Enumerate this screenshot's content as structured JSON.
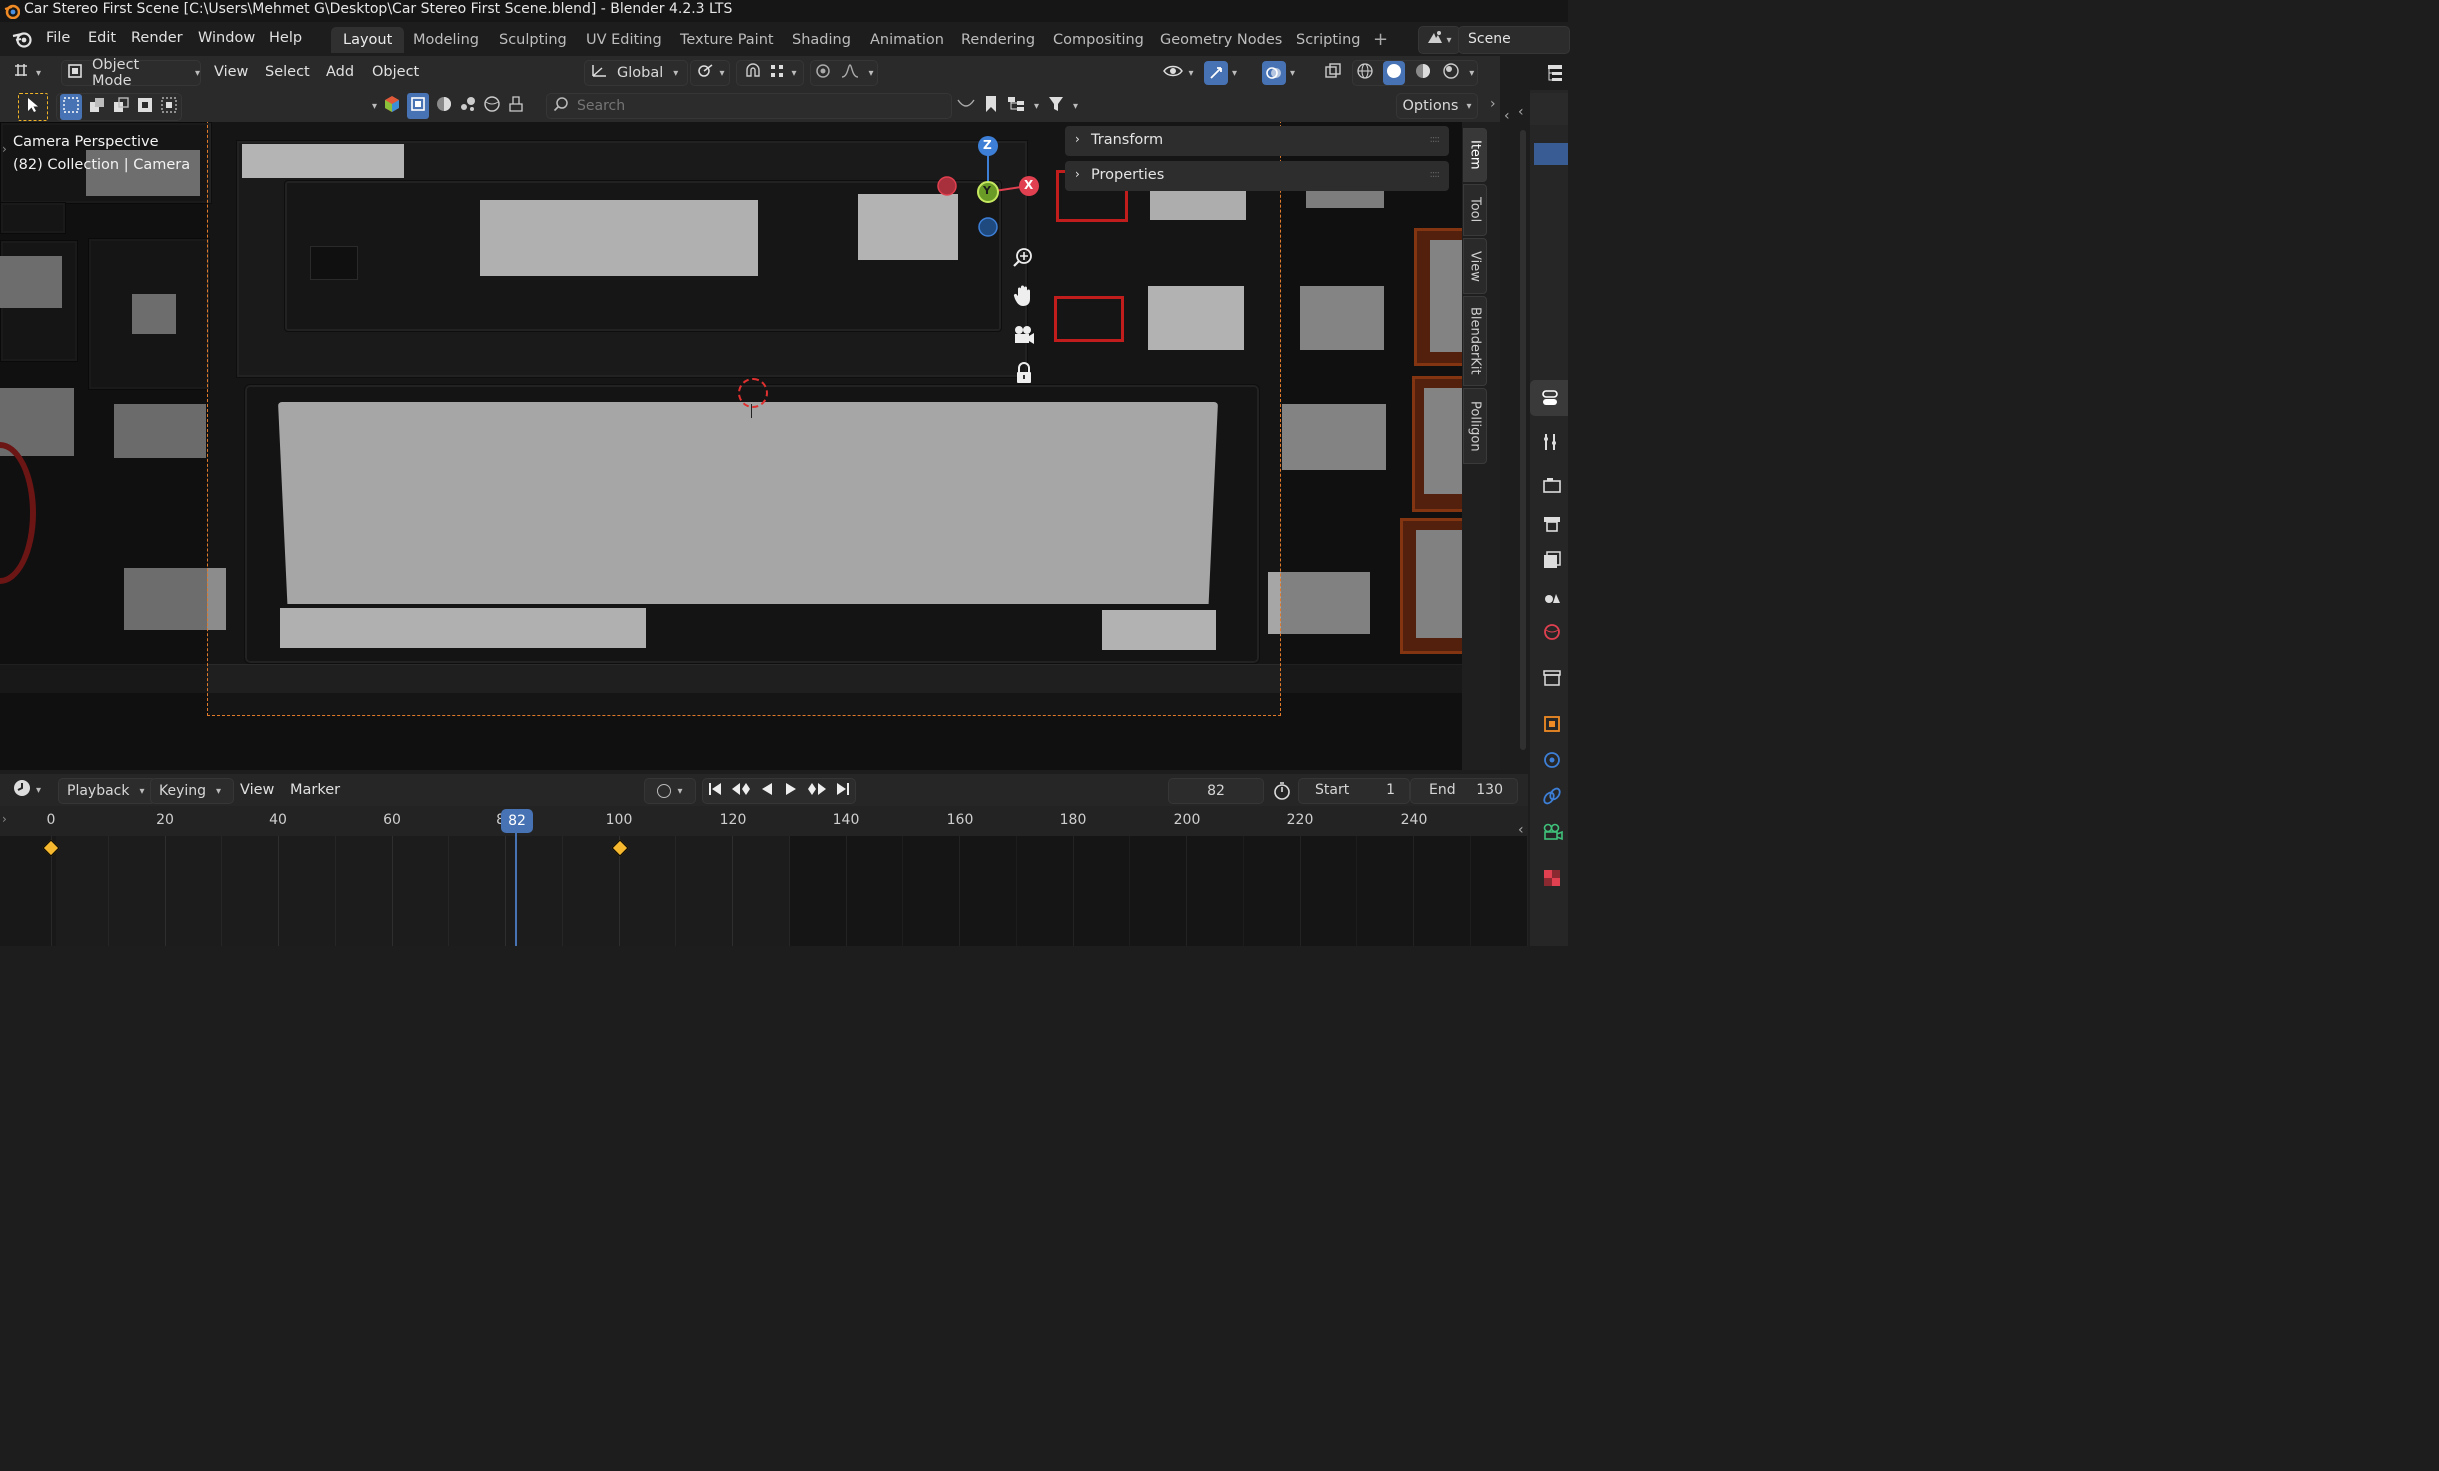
{
  "window": {
    "title": "Car Stereo First Scene [C:\\Users\\Mehmet G\\Desktop\\Car Stereo First Scene.blend] - Blender 4.2.3 LTS"
  },
  "menu": [
    "File",
    "Edit",
    "Render",
    "Window",
    "Help"
  ],
  "workspaces": [
    "Layout",
    "Modeling",
    "Sculpting",
    "UV Editing",
    "Texture Paint",
    "Shading",
    "Animation",
    "Rendering",
    "Compositing",
    "Geometry Nodes",
    "Scripting"
  ],
  "active_workspace": "Layout",
  "scene_name": "Scene",
  "header": {
    "mode": "Object Mode",
    "menus": [
      "View",
      "Select",
      "Add",
      "Object"
    ],
    "orientation": "Global",
    "search_placeholder": "Search",
    "options": "Options"
  },
  "viewport": {
    "camera_label": "Camera Perspective",
    "collection_label": "(82) Collection | Camera",
    "gizmo": {
      "z": "Z",
      "y": "Y",
      "x": "X"
    }
  },
  "npanel": {
    "sections": [
      "Transform",
      "Properties"
    ],
    "tabs": [
      "Item",
      "Tool",
      "View",
      "BlenderKit",
      "Polligon"
    ]
  },
  "timeline": {
    "menus": [
      "Playback",
      "Keying",
      "View",
      "Marker"
    ],
    "current_frame": "82",
    "start_label": "Start",
    "start": "1",
    "end_label": "End",
    "end": "130",
    "ruler": [
      "0",
      "20",
      "40",
      "60",
      "80",
      "100",
      "120",
      "140",
      "160",
      "180",
      "200",
      "220",
      "240"
    ],
    "playhead_badge": "82",
    "keyframes": [
      0,
      100
    ]
  },
  "colors": {
    "accent": "#4772b3",
    "axis_x": "#e0404f",
    "axis_y": "#8bc03a",
    "axis_z": "#3d7fd7",
    "keyframe": "#f5b82e",
    "camera_frame": "#e07a2a"
  }
}
